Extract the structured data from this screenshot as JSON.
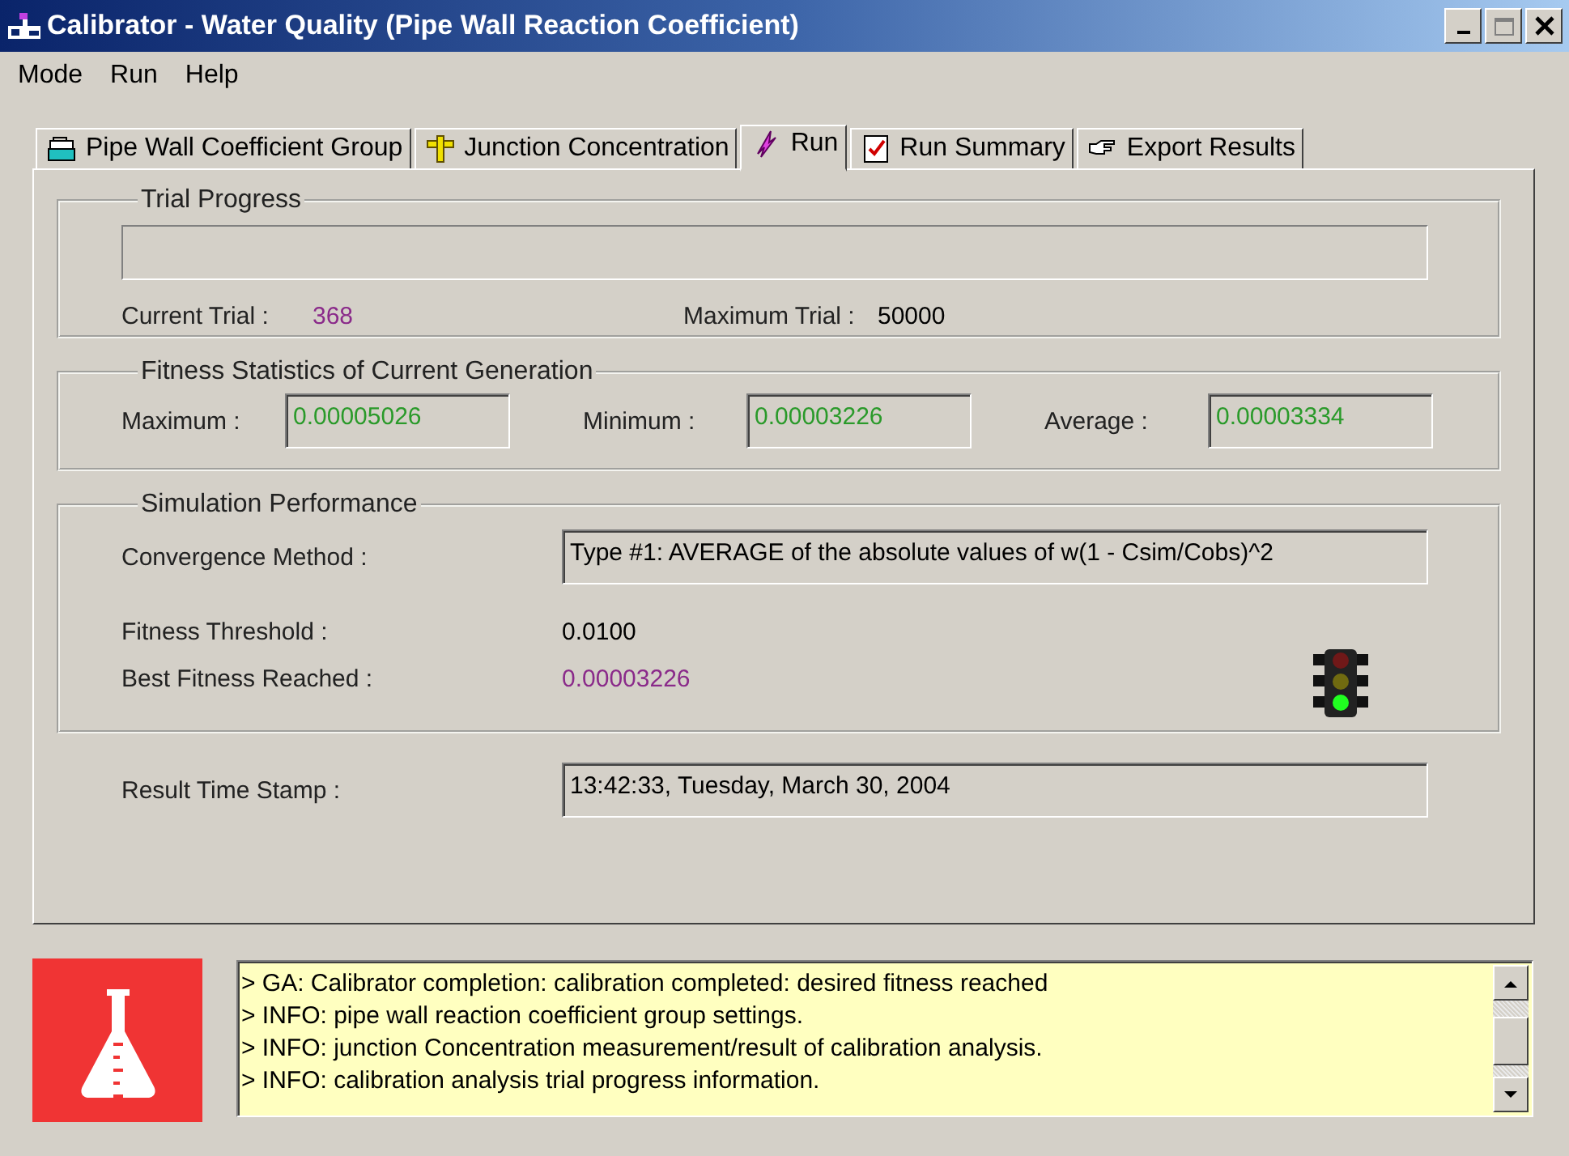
{
  "window": {
    "title": "Calibrator - Water Quality (Pipe Wall Reaction Coefficient)"
  },
  "menu": [
    "Mode",
    "Run",
    "Help"
  ],
  "tabs": [
    {
      "label": "Pipe Wall Coefficient Group",
      "selected": false
    },
    {
      "label": "Junction Concentration",
      "selected": false
    },
    {
      "label": "Run",
      "selected": true
    },
    {
      "label": "Run Summary",
      "selected": false
    },
    {
      "label": "Export Results",
      "selected": false
    }
  ],
  "trial_progress": {
    "title": "Trial Progress",
    "level": 0,
    "current_trial_label": "Current Trial :",
    "current_trial": "368",
    "maximum_trial_label": "Maximum Trial :",
    "maximum_trial": "50000"
  },
  "fitness_statistics": {
    "title": "Fitness Statistics of Current Generation",
    "fields": [
      {
        "label": "Maximum :",
        "value": "0.00005026"
      },
      {
        "label": "Minimum :",
        "value": "0.00003226"
      },
      {
        "label": "Average :",
        "value": "0.00003334"
      }
    ]
  },
  "simulation_performance": {
    "title": "Simulation Performance",
    "convergence_method_label": "Convergence Method :",
    "convergence_method": "Type #1: AVERAGE of the absolute values of w(1 - Csim/Cobs)^2",
    "fitness_threshold_label": "Fitness Threshold :",
    "fitness_threshold": "0.0100",
    "best_fitness_label": "Best Fitness Reached :",
    "best_fitness": "0.00003226"
  },
  "result_time_stamp": {
    "label": "Result Time Stamp :",
    "value": "13:42:33, Tuesday, March 30, 2004"
  },
  "log": [
    "> GA: Calibrator completion: calibration completed: desired fitness reached",
    "> INFO: pipe wall reaction coefficient group settings.",
    "> INFO: junction Concentration measurement/result of calibration analysis.",
    "> INFO: calibration analysis trial progress information."
  ]
}
